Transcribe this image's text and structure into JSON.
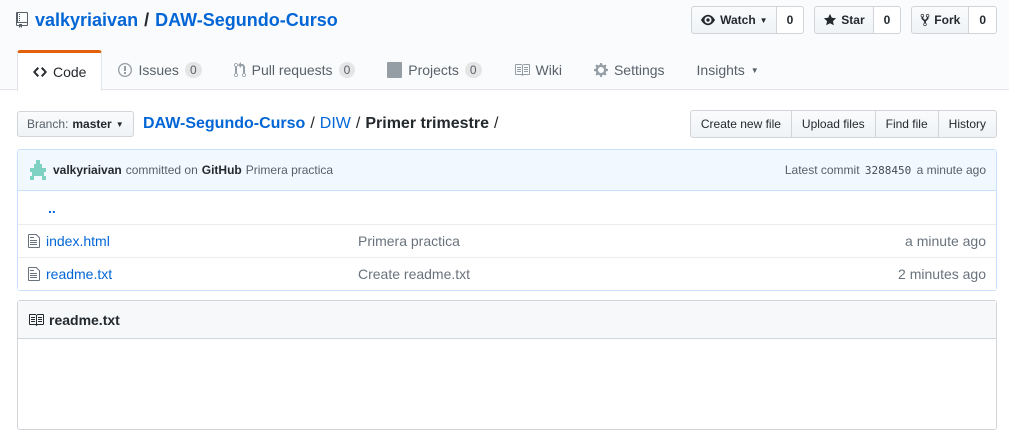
{
  "repo": {
    "owner": "valkyriaivan",
    "separator": "/",
    "name": "DAW-Segundo-Curso"
  },
  "actions": {
    "watch": {
      "label": "Watch",
      "count": "0"
    },
    "star": {
      "label": "Star",
      "count": "0"
    },
    "fork": {
      "label": "Fork",
      "count": "0"
    }
  },
  "tabs": [
    {
      "label": "Code"
    },
    {
      "label": "Issues",
      "count": "0"
    },
    {
      "label": "Pull requests",
      "count": "0"
    },
    {
      "label": "Projects",
      "count": "0"
    },
    {
      "label": "Wiki"
    },
    {
      "label": "Settings"
    },
    {
      "label": "Insights"
    }
  ],
  "branch": {
    "prefix": "Branch:",
    "name": "master"
  },
  "breadcrumb": {
    "root": "DAW-Segundo-Curso",
    "sep": "/",
    "dir": "DIW",
    "current": "Primer trimestre",
    "trail": "/"
  },
  "file_buttons": {
    "create": "Create new file",
    "upload": "Upload files",
    "find": "Find file",
    "history": "History"
  },
  "commit": {
    "user": "valkyriaivan",
    "middle": "committed on",
    "platform": "GitHub",
    "message": "Primera practica",
    "latest_label": "Latest commit",
    "sha": "3288450",
    "age": "a minute ago"
  },
  "files": {
    "up": "..",
    "rows": [
      {
        "name": "index.html",
        "message": "Primera practica",
        "age": "a minute ago"
      },
      {
        "name": "readme.txt",
        "message": "Create readme.txt",
        "age": "2 minutes ago"
      }
    ]
  },
  "readme": {
    "title": "readme.txt"
  },
  "colors": {
    "link": "#0366d6",
    "tab_accent": "#e36209",
    "commit_bg": "#f1f8ff"
  }
}
